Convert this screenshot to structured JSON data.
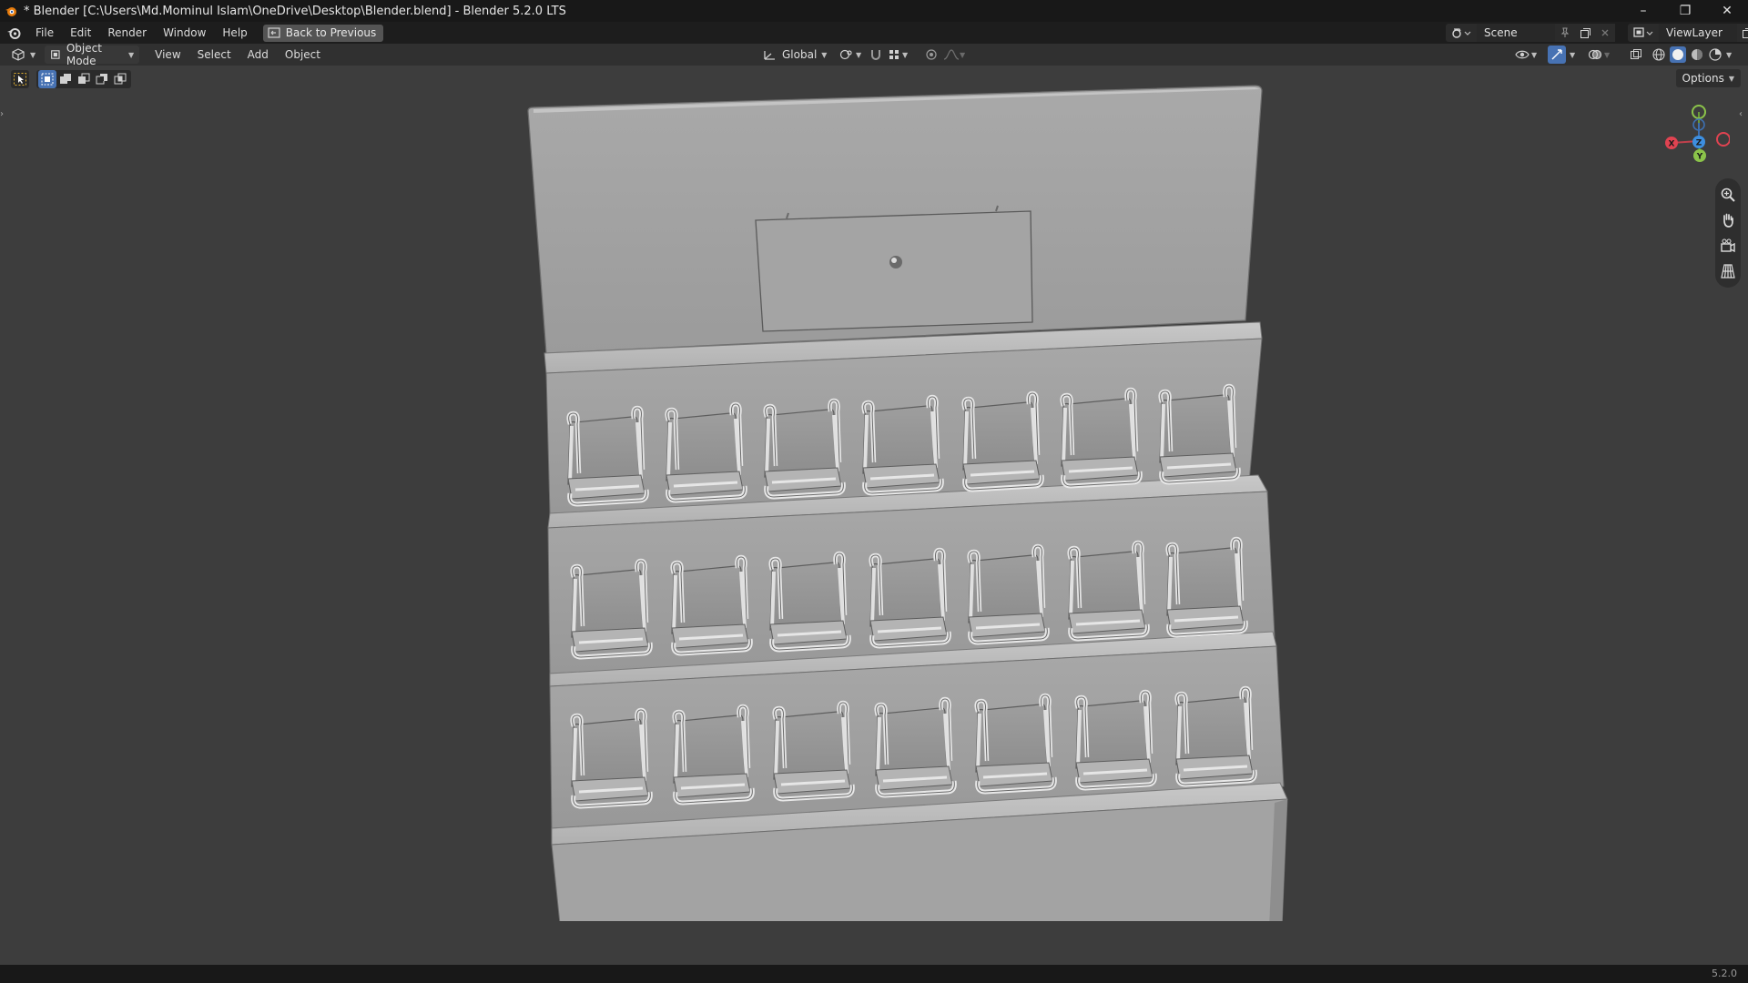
{
  "window": {
    "title": "* Blender [C:\\Users\\Md.Mominul Islam\\OneDrive\\Desktop\\Blender.blend] - Blender 5.2.0 LTS",
    "minimize": "–",
    "maximize": "❐",
    "close": "✕"
  },
  "menu": {
    "items": [
      "File",
      "Edit",
      "Render",
      "Window",
      "Help"
    ],
    "back_label": "Back to Previous"
  },
  "scene": {
    "label": "Scene"
  },
  "view_layer": {
    "label": "ViewLayer"
  },
  "viewport_header": {
    "mode": "Object Mode",
    "menus": [
      "View",
      "Select",
      "Add",
      "Object"
    ],
    "orientation": "Global"
  },
  "viewport": {
    "options_label": "Options",
    "gizmo": {
      "x": "X",
      "y": "Y",
      "z": "Z"
    }
  },
  "status": {
    "version": "5.2.0"
  },
  "colors": {
    "accent": "#4772b3",
    "axis_x": "#e04351",
    "axis_y": "#8bc34a",
    "axis_z": "#3d8fe0"
  }
}
